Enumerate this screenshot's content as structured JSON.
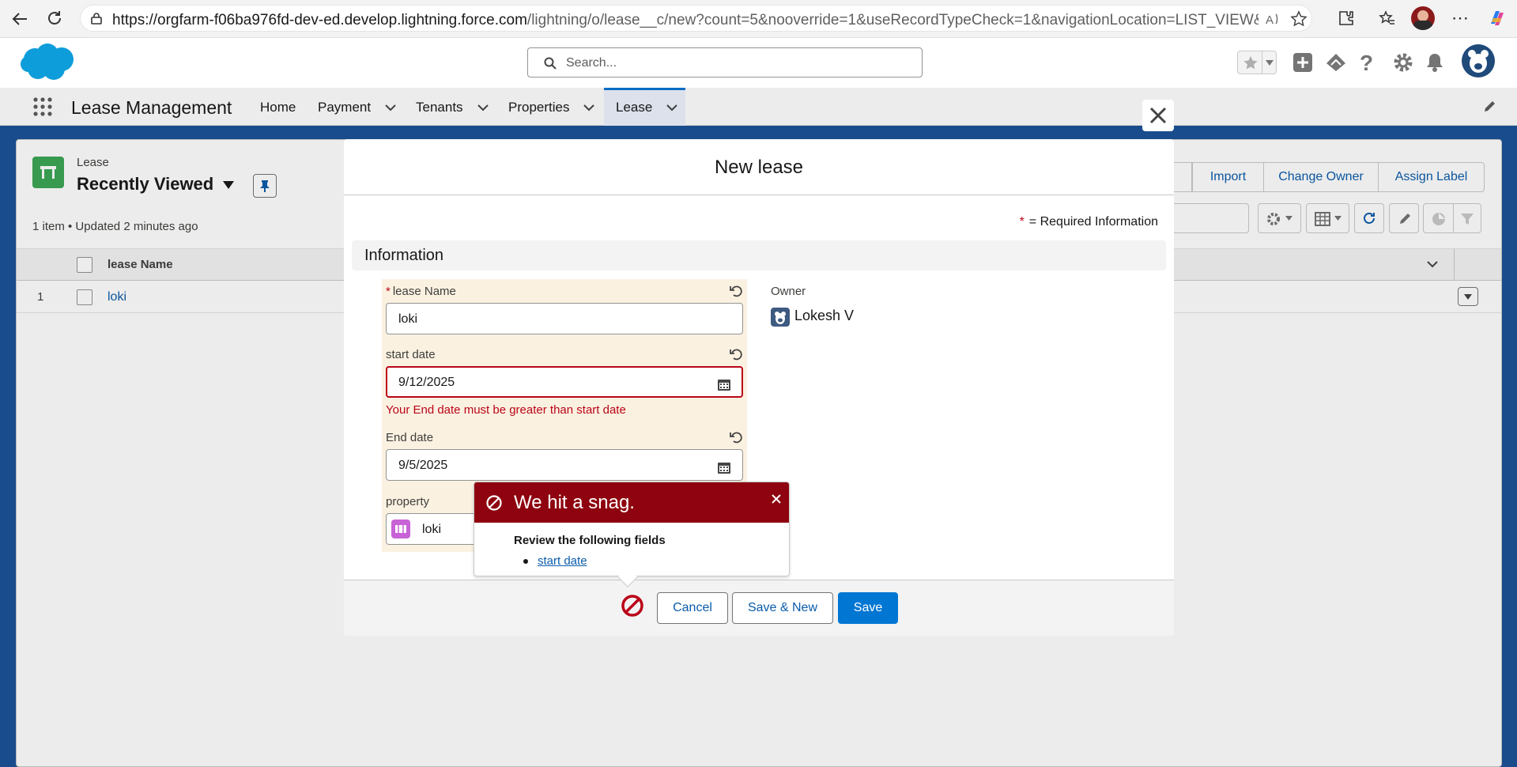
{
  "browser": {
    "url_host": "https://orgfarm-f06ba976fd-dev-ed.develop.lightning.force.com",
    "url_path": "/lightning/o/lease__c/new?count=5&nooverride=1&useRecordTypeCheck=1&navigationLocation=LIST_VIEW&uid=1757..."
  },
  "header": {
    "search_placeholder": "Search..."
  },
  "nav": {
    "app_name": "Lease Management",
    "items": [
      {
        "label": "Home"
      },
      {
        "label": "Payment"
      },
      {
        "label": "Tenants"
      },
      {
        "label": "Properties"
      },
      {
        "label": "Lease"
      }
    ]
  },
  "list_view": {
    "object_label": "Lease",
    "view_name": "Recently Viewed",
    "status": "1 item • Updated 2 minutes ago",
    "column_header": "lease Name",
    "rows": [
      {
        "num": "1",
        "name": "loki"
      }
    ],
    "buttons": [
      "Import",
      "Change Owner",
      "Assign Label"
    ]
  },
  "modal": {
    "title": "New lease",
    "required_info": "= Required Information",
    "required_star": "*",
    "section_title": "Information",
    "fields": {
      "lease_name_label": "lease Name",
      "lease_name_value": "loki",
      "start_date_label": "start date",
      "start_date_value": "9/12/2025",
      "start_date_error": "Your End date must be greater than start date",
      "end_date_label": "End date",
      "end_date_value": "9/5/2025",
      "property_label": "property",
      "property_value": "loki",
      "owner_label": "Owner",
      "owner_value": "Lokesh V"
    },
    "footer": {
      "cancel": "Cancel",
      "save_new": "Save & New",
      "save": "Save"
    }
  },
  "error_popover": {
    "title": "We hit a snag.",
    "body": "Review the following fields",
    "links": [
      "start date"
    ]
  },
  "colors": {
    "brand": "#0176d3",
    "error": "#ba0517",
    "popover_header": "#8e030f",
    "field_highlight": "#fbf1e1"
  }
}
